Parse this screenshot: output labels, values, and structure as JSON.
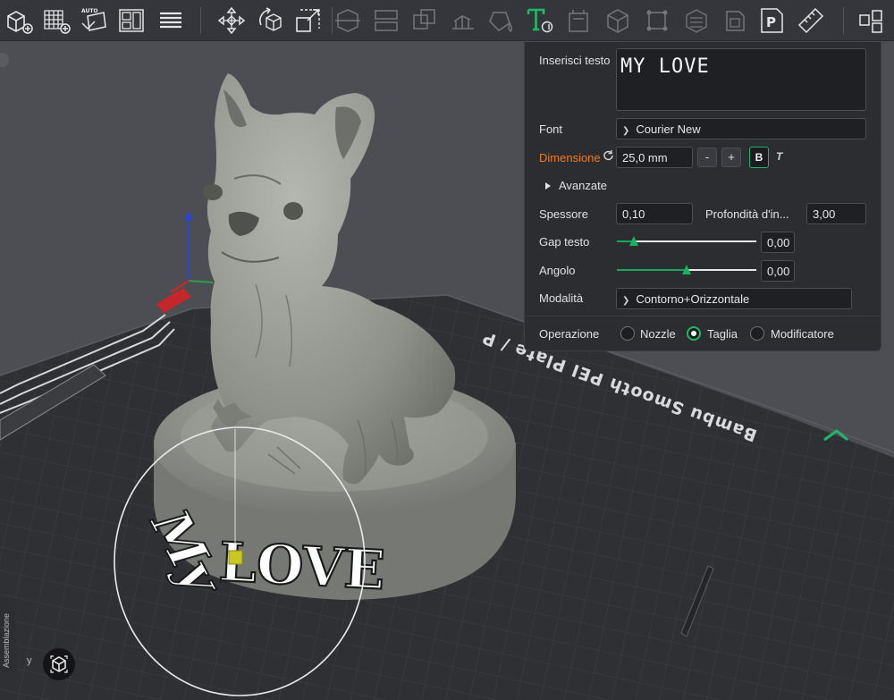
{
  "toolbar": {
    "tools": [
      {
        "name": "add-plate-icon",
        "enabled": true
      },
      {
        "name": "grid-add-icon",
        "enabled": true
      },
      {
        "name": "auto-orient-icon",
        "enabled": true,
        "label": "AUTO"
      },
      {
        "name": "arrange-icon",
        "enabled": true
      },
      {
        "name": "layers-list-icon",
        "enabled": true
      },
      {
        "name": "move-icon",
        "enabled": true
      },
      {
        "name": "rotate-icon",
        "enabled": true
      },
      {
        "name": "scale-icon",
        "enabled": true
      },
      {
        "name": "cut-icon",
        "enabled": false
      },
      {
        "name": "split-icon",
        "enabled": false
      },
      {
        "name": "boolean-icon",
        "enabled": false
      },
      {
        "name": "support-paint-icon",
        "enabled": false
      },
      {
        "name": "color-paint-icon",
        "enabled": false
      },
      {
        "name": "text-tool-icon",
        "enabled": true,
        "active": true
      },
      {
        "name": "svg-icon",
        "enabled": false
      },
      {
        "name": "mesh-icon",
        "enabled": false
      },
      {
        "name": "fix-model-icon",
        "enabled": false
      },
      {
        "name": "hollow-icon",
        "enabled": false
      },
      {
        "name": "brim-icon",
        "enabled": false
      },
      {
        "name": "plate-p-icon",
        "enabled": true,
        "label": "P"
      },
      {
        "name": "measure-icon",
        "enabled": true
      },
      {
        "name": "assembly-icon",
        "enabled": true
      }
    ]
  },
  "viewport": {
    "plate_label": "Bambu Smooth PEI Plate / P",
    "model_text_line1": "My",
    "model_text_line2": "LOVE",
    "axis_y_label": "y",
    "side_tab_label": "Assemblazione"
  },
  "text_panel": {
    "text_label": "Inserisci testo",
    "text_value": "MY LOVE",
    "font_label": "Font",
    "font_value": "Courier New",
    "size_label": "Dimensione",
    "size_value": "25,0 mm",
    "minus_label": "-",
    "plus_label": "+",
    "bold_label": "B",
    "italic_label": "T",
    "advanced_label": "Avanzate",
    "thickness_label": "Spessore",
    "thickness_value": "0,10",
    "depth_label": "Profondità d'in...",
    "depth_value": "3,00",
    "gap_label": "Gap testo",
    "gap_value": "0,00",
    "gap_slider_level": 0.12,
    "angle_label": "Angolo",
    "angle_value": "0,00",
    "angle_slider_level": 0.5,
    "mode_label": "Modalità",
    "mode_value": "Contorno+Orizzontale",
    "operation_label": "Operazione",
    "operations": [
      {
        "label": "Nozzle",
        "selected": false
      },
      {
        "label": "Taglia",
        "selected": true
      },
      {
        "label": "Modificatore",
        "selected": false
      }
    ]
  },
  "colors": {
    "accent_green": "#1fb868",
    "size_label_orange": "#f07a1a",
    "panel_bg": "#2c2d31",
    "toolbar_bg": "#35363b"
  }
}
